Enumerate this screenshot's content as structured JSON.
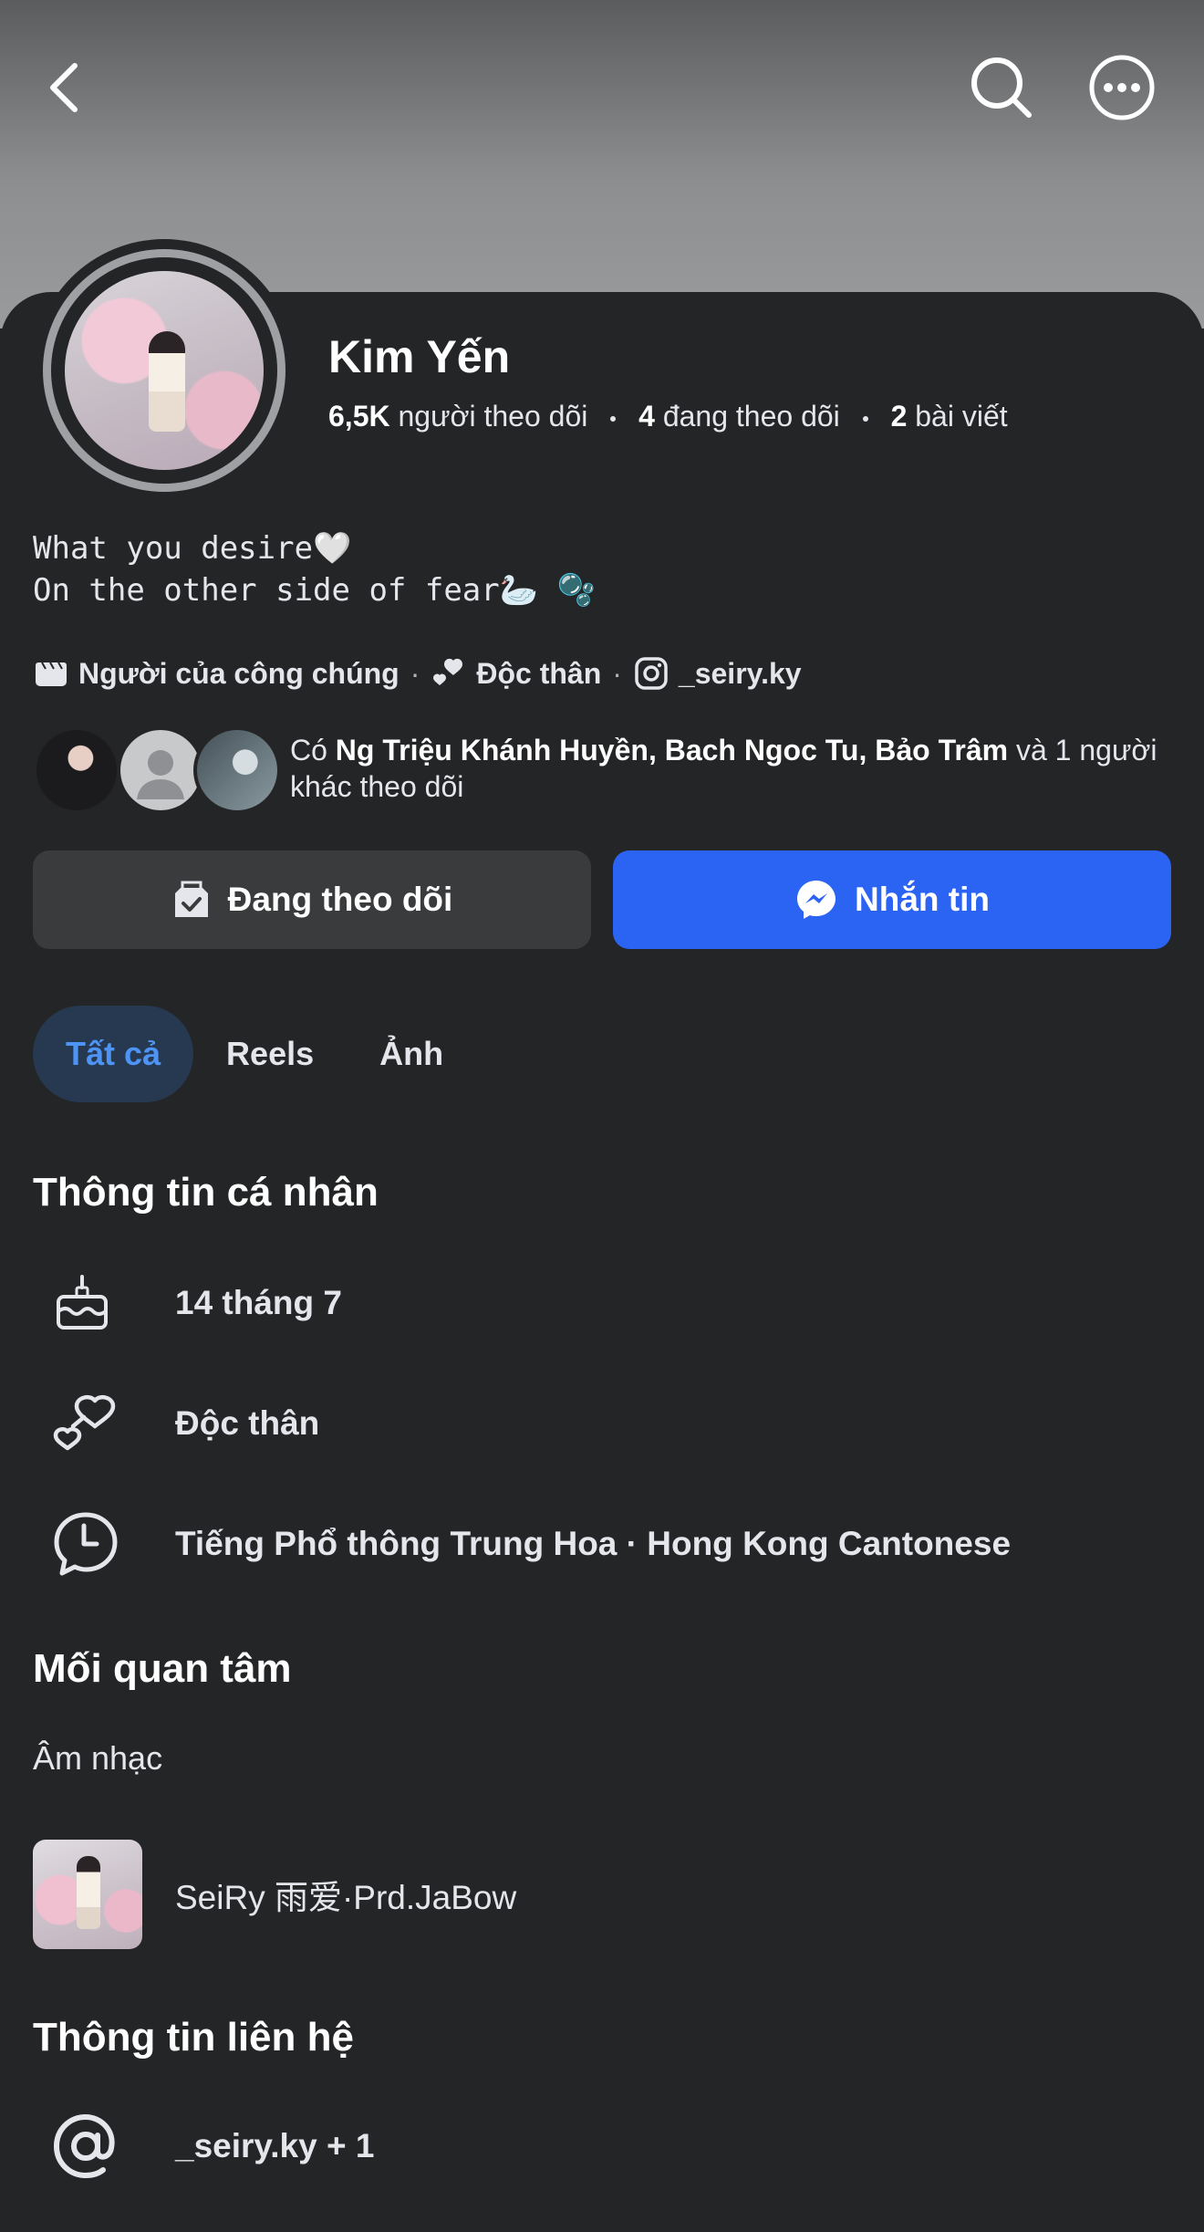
{
  "header": {
    "back_icon": "chevron-left-icon",
    "search_icon": "search-icon",
    "more_icon": "more-horizontal-icon"
  },
  "profile": {
    "name": "Kim Yến",
    "followers_count": "6,5K",
    "followers_label": "người theo dõi",
    "following_count": "4",
    "following_label": "đang theo dõi",
    "posts_count": "2",
    "posts_label": "bài viết",
    "bio_line1": "What you desire🤍",
    "bio_line2": "On the other side of fear🦢 🫧"
  },
  "meta": {
    "category": "Người của công chúng",
    "relationship": "Độc thân",
    "instagram": "_seiry.ky"
  },
  "mutual": {
    "prefix": "Có",
    "names": "Ng Triệu Khánh Huyền, Bach Ngoc Tu, Bảo Trâm",
    "suffix": "và 1 người khác theo dõi"
  },
  "actions": {
    "following_label": "Đang theo dõi",
    "message_label": "Nhắn tin",
    "message_color": "#2b63f3"
  },
  "tabs": [
    {
      "label": "Tất cả",
      "active": true
    },
    {
      "label": "Reels",
      "active": false
    },
    {
      "label": "Ảnh",
      "active": false
    }
  ],
  "personal_info": {
    "title": "Thông tin cá nhân",
    "birthday": "14 tháng 7",
    "relationship": "Độc thân",
    "languages": "Tiếng Phổ thông Trung Hoa · Hong Kong Cantonese"
  },
  "interests": {
    "title": "Mối quan tâm",
    "category": "Âm nhạc",
    "item": "SeiRy 雨爱·Prd.JaBow"
  },
  "contact": {
    "title": "Thông tin liên hệ",
    "value": "_seiry.ky + 1"
  }
}
